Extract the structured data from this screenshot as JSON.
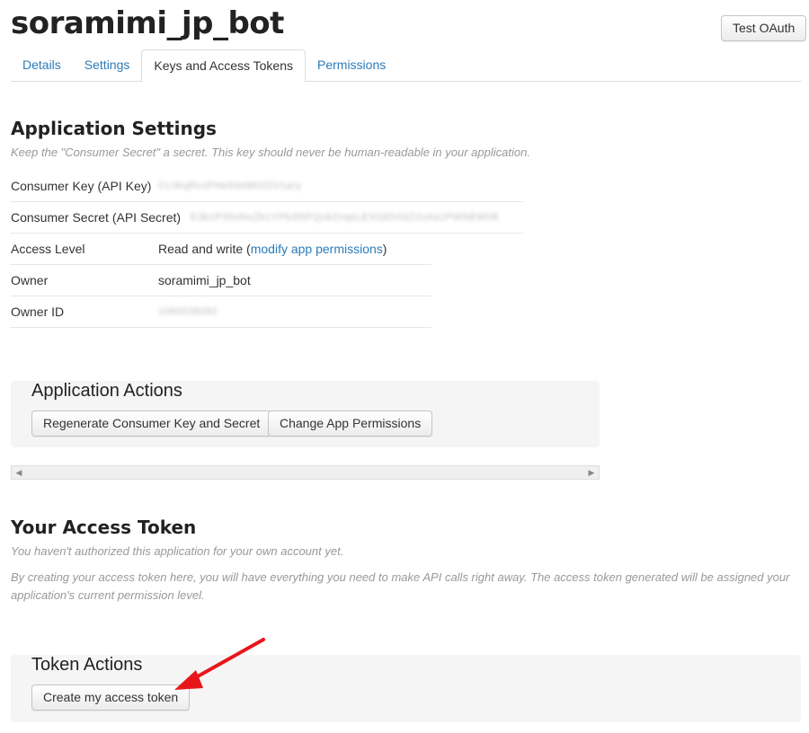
{
  "app": {
    "title": "soramimi_jp_bot",
    "test_oauth_label": "Test OAuth"
  },
  "tabs": [
    {
      "label": "Details"
    },
    {
      "label": "Settings"
    },
    {
      "label": "Keys and Access Tokens",
      "active": true
    },
    {
      "label": "Permissions"
    }
  ],
  "application_settings": {
    "heading": "Application Settings",
    "hint": "Keep the \"Consumer Secret\" a secret. This key should never be human-readable in your application.",
    "consumer_key_label": "Consumer Key (API Key)",
    "consumer_key_value": "CL0kqRvxPHe54eM0ZZV1ary",
    "consumer_secret_label": "Consumer Secret (API Secret)",
    "consumer_secret_value": "E3b1P30sNxZb1YPb3f0FQukZnqsLEXGEhOtZ2vAa1PWNEW08",
    "access_level_label": "Access Level",
    "access_level_text": "Read and write (",
    "access_level_link": "modify app permissions",
    "access_level_close": ")",
    "owner_label": "Owner",
    "owner_value": "soramimi_jp_bot",
    "owner_id_label": "Owner ID",
    "owner_id_value": "1060038082"
  },
  "application_actions": {
    "title": "Application Actions",
    "regenerate_label": "Regenerate Consumer Key and Secret",
    "change_permissions_label": "Change App Permissions"
  },
  "access_token": {
    "heading": "Your Access Token",
    "hint1": "You haven't authorized this application for your own account yet.",
    "hint2": "By creating your access token here, you will have everything you need to make API calls right away. The access token generated will be assigned your application's current permission level."
  },
  "token_actions": {
    "title": "Token Actions",
    "create_label": "Create my access token"
  },
  "colors": {
    "link": "#2b7bb9",
    "annotation_arrow": "#e8161b"
  }
}
